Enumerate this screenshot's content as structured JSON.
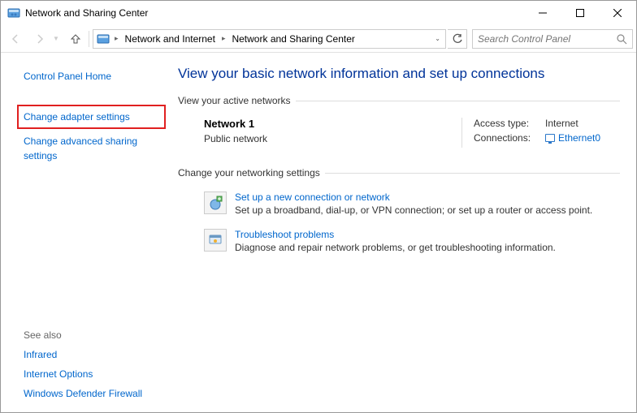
{
  "titlebar": {
    "title": "Network and Sharing Center"
  },
  "navbar": {
    "breadcrumb": {
      "seg1": "Network and Internet",
      "seg2": "Network and Sharing Center"
    },
    "search_placeholder": "Search Control Panel"
  },
  "sidebar": {
    "home": "Control Panel Home",
    "links": {
      "adapter": "Change adapter settings",
      "advanced": "Change advanced sharing settings"
    },
    "seealso_label": "See also",
    "seealso": {
      "infrared": "Infrared",
      "internet": "Internet Options",
      "firewall": "Windows Defender Firewall"
    }
  },
  "main": {
    "heading": "View your basic network information and set up connections",
    "active_label": "View your active networks",
    "network": {
      "name": "Network 1",
      "type": "Public network",
      "access_label": "Access type:",
      "access_value": "Internet",
      "conn_label": "Connections:",
      "conn_value": "Ethernet0"
    },
    "change_label": "Change your networking settings",
    "opts": {
      "setup_title": "Set up a new connection or network",
      "setup_desc": "Set up a broadband, dial-up, or VPN connection; or set up a router or access point.",
      "troubleshoot_title": "Troubleshoot problems",
      "troubleshoot_desc": "Diagnose and repair network problems, or get troubleshooting information."
    }
  }
}
